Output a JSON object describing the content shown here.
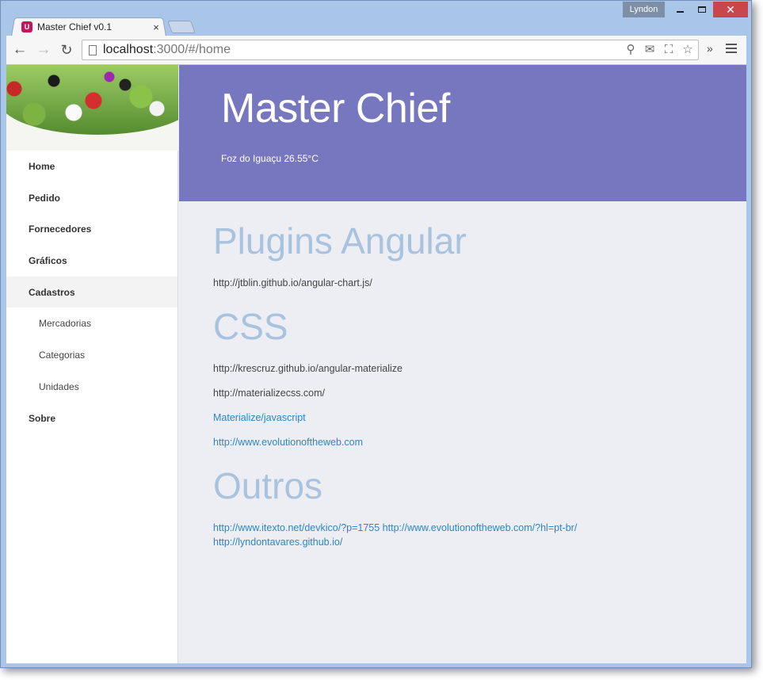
{
  "browser": {
    "profile_name": "Lyndon",
    "tab_title": "Master Chief v0.1",
    "tab_close": "×",
    "url_host": "localhost",
    "url_path": ":3000/#/home",
    "icons": [
      "back-arrow-icon",
      "forward-arrow-icon",
      "reload-icon",
      "page-icon",
      "zoom-icon",
      "mail-icon",
      "translate-icon",
      "star-icon",
      "extensions-chevron-icon",
      "menu-icon"
    ]
  },
  "sidebar": {
    "items": [
      {
        "label": "Home"
      },
      {
        "label": "Pedido"
      },
      {
        "label": "Fornecedores"
      },
      {
        "label": "Gráficos"
      },
      {
        "label": "Cadastros"
      },
      {
        "label": "Mercadorias"
      },
      {
        "label": "Categorias"
      },
      {
        "label": "Unidades"
      },
      {
        "label": "Sobre"
      }
    ]
  },
  "header": {
    "title": "Master Chief",
    "weather": "Foz do Iguaçu 26.55°C"
  },
  "main": {
    "plugins_title": "Plugins Angular",
    "plugins_link": "http://jtblin.github.io/angular-chart.js/",
    "css_title": "CSS",
    "css_links": [
      "http://krescruz.github.io/angular-materialize",
      "http://materializecss.com/",
      "Materialize/javascript",
      "http://www.evolutionoftheweb.com"
    ],
    "outros_title": "Outros",
    "outros_line1": "http://www.itexto.net/devkico/?p=1755 http://www.evolutionoftheweb.com/?hl=pt-br/",
    "outros_line2": "http://lyndontavares.github.io/"
  },
  "colors": {
    "header_bg": "#7777bf",
    "section_title": "#a9c3df",
    "link": "#2a86c8",
    "content_bg": "#edeef3"
  }
}
